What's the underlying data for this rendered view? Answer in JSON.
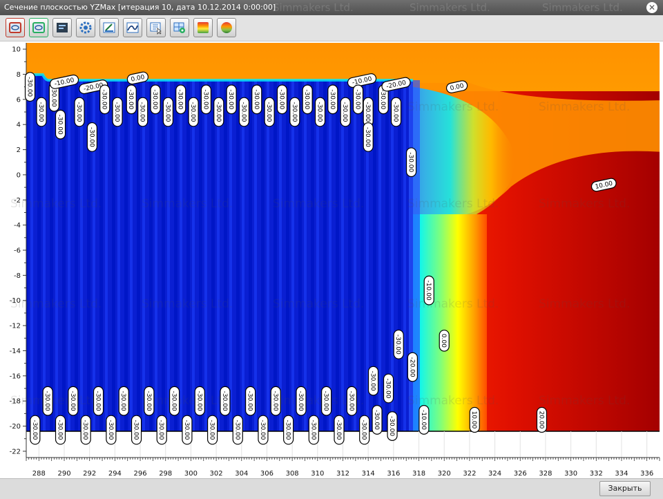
{
  "window": {
    "title": "Сечение плоскостью YZMax [итерация 10, дата 10.12.2014 0:00:00]",
    "watermark": "Simmakers Ltd.",
    "close_icon": "close-circle-icon"
  },
  "toolbar": {
    "buttons": [
      {
        "name": "frame-red-icon",
        "color": "#c0392b"
      },
      {
        "name": "frame-green-icon",
        "color": "#27ae60"
      },
      {
        "name": "list-panel-icon",
        "color": "#2c3e50"
      },
      {
        "name": "settings-gear-icon",
        "color": "#3a7bd5"
      },
      {
        "name": "draw-section-icon",
        "color": "#1e88c8"
      },
      {
        "name": "line-chart-icon",
        "color": "#1e88c8"
      },
      {
        "name": "cursor-select-icon",
        "color": "#1e88c8"
      },
      {
        "name": "grid-settings-icon",
        "color": "#1e88c8"
      },
      {
        "name": "color-palette-icon",
        "color": "#e74c3c"
      },
      {
        "name": "color-wheel-icon",
        "color": "#e67e22"
      }
    ]
  },
  "chart_data": {
    "type": "heatmap",
    "title": "",
    "xlabel": "",
    "ylabel": "",
    "xlim": [
      287,
      337
    ],
    "ylim": [
      -22.5,
      10.5
    ],
    "x_ticks": [
      "288",
      "290",
      "292",
      "294",
      "296",
      "298",
      "300",
      "302",
      "304",
      "306",
      "308",
      "310",
      "312",
      "314",
      "316",
      "318",
      "320",
      "322",
      "324",
      "326",
      "328",
      "330",
      "332",
      "334",
      "336"
    ],
    "y_ticks": [
      "10",
      "8",
      "6",
      "4",
      "2",
      "0",
      "-2",
      "-4",
      "-6",
      "-8",
      "-10",
      "-12",
      "-14",
      "-16",
      "-18",
      "-20",
      "-22"
    ],
    "colors": {
      "frozen": "#0a1fd2",
      "cold": "#1f8fff",
      "near_zero": "#00f0ff",
      "warm": "#ff2200",
      "hot": "#a80000",
      "surface": "#ff9500"
    },
    "contour_labels": [
      {
        "text": "-30.00",
        "x": 287.3,
        "y": 7.0,
        "vertical": true
      },
      {
        "text": "-30.00",
        "x": 288.2,
        "y": 5.0,
        "vertical": true
      },
      {
        "text": "-30.00",
        "x": 289.2,
        "y": 6.2,
        "vertical": true
      },
      {
        "text": "-30.00",
        "x": 289.7,
        "y": 4.0,
        "vertical": true
      },
      {
        "text": "-10.00",
        "x": 290.0,
        "y": 7.4,
        "vertical": false
      },
      {
        "text": "-20.00",
        "x": 292.3,
        "y": 7.0,
        "vertical": false
      },
      {
        "text": "-30.00",
        "x": 291.2,
        "y": 5.0,
        "vertical": true
      },
      {
        "text": "-30.00",
        "x": 292.2,
        "y": 3.0,
        "vertical": true
      },
      {
        "text": "-30.00",
        "x": 293.2,
        "y": 6.0,
        "vertical": true
      },
      {
        "text": "-30.00",
        "x": 294.2,
        "y": 5.0,
        "vertical": true
      },
      {
        "text": "0.00",
        "x": 295.8,
        "y": 7.7,
        "vertical": false
      },
      {
        "text": "-30.00",
        "x": 295.3,
        "y": 6.0,
        "vertical": true
      },
      {
        "text": "-30.00",
        "x": 296.2,
        "y": 5.0,
        "vertical": true
      },
      {
        "text": "-30.00",
        "x": 297.2,
        "y": 6.0,
        "vertical": true
      },
      {
        "text": "-30.00",
        "x": 298.2,
        "y": 5.0,
        "vertical": true
      },
      {
        "text": "-30.00",
        "x": 299.2,
        "y": 6.0,
        "vertical": true
      },
      {
        "text": "-30.00",
        "x": 300.2,
        "y": 5.0,
        "vertical": true
      },
      {
        "text": "-30.00",
        "x": 301.2,
        "y": 6.0,
        "vertical": true
      },
      {
        "text": "-30.00",
        "x": 302.2,
        "y": 5.0,
        "vertical": true
      },
      {
        "text": "-30.00",
        "x": 303.2,
        "y": 6.0,
        "vertical": true
      },
      {
        "text": "-30.00",
        "x": 304.2,
        "y": 5.0,
        "vertical": true
      },
      {
        "text": "-30.00",
        "x": 305.2,
        "y": 6.0,
        "vertical": true
      },
      {
        "text": "-30.00",
        "x": 306.2,
        "y": 5.0,
        "vertical": true
      },
      {
        "text": "-30.00",
        "x": 307.2,
        "y": 6.0,
        "vertical": true
      },
      {
        "text": "-30.00",
        "x": 308.2,
        "y": 5.0,
        "vertical": true
      },
      {
        "text": "-30.00",
        "x": 309.2,
        "y": 6.0,
        "vertical": true
      },
      {
        "text": "-30.00",
        "x": 310.2,
        "y": 5.0,
        "vertical": true
      },
      {
        "text": "-30.00",
        "x": 311.2,
        "y": 6.0,
        "vertical": true
      },
      {
        "text": "-30.00",
        "x": 312.2,
        "y": 5.0,
        "vertical": true
      },
      {
        "text": "-10.00",
        "x": 313.5,
        "y": 7.5,
        "vertical": false
      },
      {
        "text": "-30.00",
        "x": 313.2,
        "y": 6.0,
        "vertical": true
      },
      {
        "text": "-30.00",
        "x": 314.0,
        "y": 5.0,
        "vertical": true
      },
      {
        "text": "-30.00",
        "x": 314.0,
        "y": 3.0,
        "vertical": true
      },
      {
        "text": "-30.00",
        "x": 315.2,
        "y": 6.0,
        "vertical": true
      },
      {
        "text": "-20.00",
        "x": 316.2,
        "y": 7.2,
        "vertical": false
      },
      {
        "text": "-30.00",
        "x": 316.2,
        "y": 5.0,
        "vertical": true
      },
      {
        "text": "0.00",
        "x": 321.0,
        "y": 7.0,
        "vertical": false
      },
      {
        "text": "-30.00",
        "x": 317.4,
        "y": 1.0,
        "vertical": true
      },
      {
        "text": "10.00",
        "x": 332.6,
        "y": -0.8,
        "vertical": false
      },
      {
        "text": "-10.00",
        "x": 318.8,
        "y": -9.2,
        "vertical": true
      },
      {
        "text": "0.00",
        "x": 320.0,
        "y": -13.2,
        "vertical": true
      },
      {
        "text": "-30.00",
        "x": 316.4,
        "y": -13.5,
        "vertical": true
      },
      {
        "text": "-20.00",
        "x": 317.5,
        "y": -15.3,
        "vertical": true
      },
      {
        "text": "-30.00",
        "x": 314.4,
        "y": -16.4,
        "vertical": true
      },
      {
        "text": "-30.00",
        "x": 315.6,
        "y": -17.0,
        "vertical": true
      },
      {
        "text": "-30.00",
        "x": 288.7,
        "y": -18.0,
        "vertical": true
      },
      {
        "text": "-30.00",
        "x": 290.7,
        "y": -18.0,
        "vertical": true
      },
      {
        "text": "-30.00",
        "x": 292.7,
        "y": -18.0,
        "vertical": true
      },
      {
        "text": "-30.00",
        "x": 294.7,
        "y": -18.0,
        "vertical": true
      },
      {
        "text": "-30.00",
        "x": 296.7,
        "y": -18.0,
        "vertical": true
      },
      {
        "text": "-30.00",
        "x": 298.7,
        "y": -18.0,
        "vertical": true
      },
      {
        "text": "-30.00",
        "x": 300.7,
        "y": -18.0,
        "vertical": true
      },
      {
        "text": "-30.00",
        "x": 302.7,
        "y": -18.0,
        "vertical": true
      },
      {
        "text": "-30.00",
        "x": 304.7,
        "y": -18.0,
        "vertical": true
      },
      {
        "text": "-30.00",
        "x": 306.7,
        "y": -18.0,
        "vertical": true
      },
      {
        "text": "-30.00",
        "x": 308.7,
        "y": -18.0,
        "vertical": true
      },
      {
        "text": "-30.00",
        "x": 310.7,
        "y": -18.0,
        "vertical": true
      },
      {
        "text": "-30.00",
        "x": 312.7,
        "y": -18.0,
        "vertical": true
      },
      {
        "text": "-30.00",
        "x": 314.7,
        "y": -19.5,
        "vertical": true
      },
      {
        "text": "-30.00",
        "x": 287.7,
        "y": -20.3,
        "vertical": true
      },
      {
        "text": "-30.00",
        "x": 289.7,
        "y": -20.3,
        "vertical": true
      },
      {
        "text": "-30.00",
        "x": 291.7,
        "y": -20.3,
        "vertical": true
      },
      {
        "text": "-30.00",
        "x": 293.7,
        "y": -20.3,
        "vertical": true
      },
      {
        "text": "-30.00",
        "x": 295.7,
        "y": -20.3,
        "vertical": true
      },
      {
        "text": "-30.00",
        "x": 297.7,
        "y": -20.3,
        "vertical": true
      },
      {
        "text": "-30.00",
        "x": 299.7,
        "y": -20.3,
        "vertical": true
      },
      {
        "text": "-30.00",
        "x": 301.7,
        "y": -20.3,
        "vertical": true
      },
      {
        "text": "-30.00",
        "x": 303.7,
        "y": -20.3,
        "vertical": true
      },
      {
        "text": "-30.00",
        "x": 305.7,
        "y": -20.3,
        "vertical": true
      },
      {
        "text": "-30.00",
        "x": 307.7,
        "y": -20.3,
        "vertical": true
      },
      {
        "text": "-30.00",
        "x": 309.7,
        "y": -20.3,
        "vertical": true
      },
      {
        "text": "-30.00",
        "x": 311.7,
        "y": -20.3,
        "vertical": true
      },
      {
        "text": "-30.00",
        "x": 313.7,
        "y": -20.3,
        "vertical": true
      },
      {
        "text": "-30.00",
        "x": 315.9,
        "y": -20.0,
        "vertical": true
      },
      {
        "text": "-10.00",
        "x": 318.4,
        "y": -19.5,
        "vertical": true
      },
      {
        "text": "10.00",
        "x": 322.4,
        "y": -19.5,
        "vertical": true
      },
      {
        "text": "20.00",
        "x": 327.7,
        "y": -19.5,
        "vertical": true
      }
    ]
  },
  "footer": {
    "close_label": "Закрыть"
  }
}
